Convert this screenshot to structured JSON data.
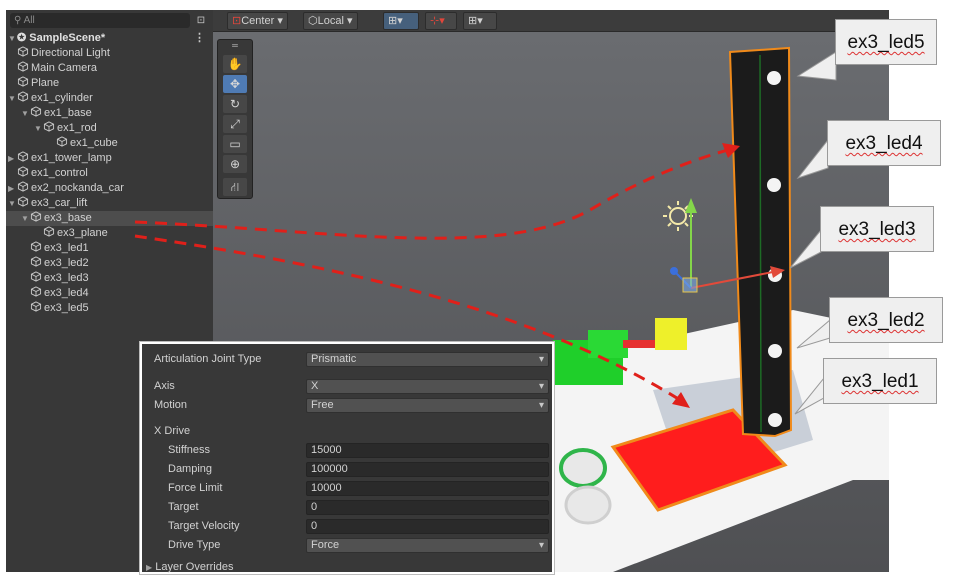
{
  "hierarchy": {
    "search_placeholder": "All",
    "scene": {
      "name": "SampleScene*",
      "menu": "⋮"
    },
    "items": [
      {
        "label": "Directional Light",
        "depth": 1,
        "arrow": ""
      },
      {
        "label": "Main Camera",
        "depth": 1,
        "arrow": ""
      },
      {
        "label": "Plane",
        "depth": 1,
        "arrow": ""
      },
      {
        "label": "ex1_cylinder",
        "depth": 1,
        "arrow": "▼"
      },
      {
        "label": "ex1_base",
        "depth": 2,
        "arrow": "▼"
      },
      {
        "label": "ex1_rod",
        "depth": 3,
        "arrow": "▼"
      },
      {
        "label": "ex1_cube",
        "depth": 4,
        "arrow": ""
      },
      {
        "label": "ex1_tower_lamp",
        "depth": 1,
        "arrow": "▶"
      },
      {
        "label": "ex1_control",
        "depth": 1,
        "arrow": ""
      },
      {
        "label": "ex2_nockanda_car",
        "depth": 1,
        "arrow": "▶"
      },
      {
        "label": "ex3_car_lift",
        "depth": 1,
        "arrow": "▼"
      },
      {
        "label": "ex3_base",
        "depth": 2,
        "arrow": "▼"
      },
      {
        "label": "ex3_plane",
        "depth": 3,
        "arrow": ""
      },
      {
        "label": "ex3_led1",
        "depth": 2,
        "arrow": ""
      },
      {
        "label": "ex3_led2",
        "depth": 2,
        "arrow": ""
      },
      {
        "label": "ex3_led3",
        "depth": 2,
        "arrow": ""
      },
      {
        "label": "ex3_led4",
        "depth": 2,
        "arrow": ""
      },
      {
        "label": "ex3_led5",
        "depth": 2,
        "arrow": ""
      }
    ]
  },
  "toolbar": {
    "pivot_label": "Center",
    "space_label": "Local",
    "dropdown_glyph": "▾"
  },
  "inspector": {
    "joint_type_label": "Articulation Joint Type",
    "joint_type_value": "Prismatic",
    "axis_label": "Axis",
    "axis_value": "X",
    "motion_label": "Motion",
    "motion_value": "Free",
    "drive_header": "X Drive",
    "stiffness_label": "Stiffness",
    "stiffness_value": "15000",
    "damping_label": "Damping",
    "damping_value": "100000",
    "force_limit_label": "Force Limit",
    "force_limit_value": "10000",
    "target_label": "Target",
    "target_value": "0",
    "target_velocity_label": "Target Velocity",
    "target_velocity_value": "0",
    "drive_type_label": "Drive Type",
    "drive_type_value": "Force",
    "layer_overrides_label": "Layer Overrides"
  },
  "callouts": {
    "led5": "ex3_led5",
    "led4": "ex3_led4",
    "led3": "ex3_led3",
    "led2": "ex3_led2",
    "led1": "ex3_led1"
  },
  "colors": {
    "arrow": "#e0201a",
    "plane_red": "#ff1d1d",
    "selection_outline": "#f08a1a",
    "tower": "#1b1b1b"
  }
}
